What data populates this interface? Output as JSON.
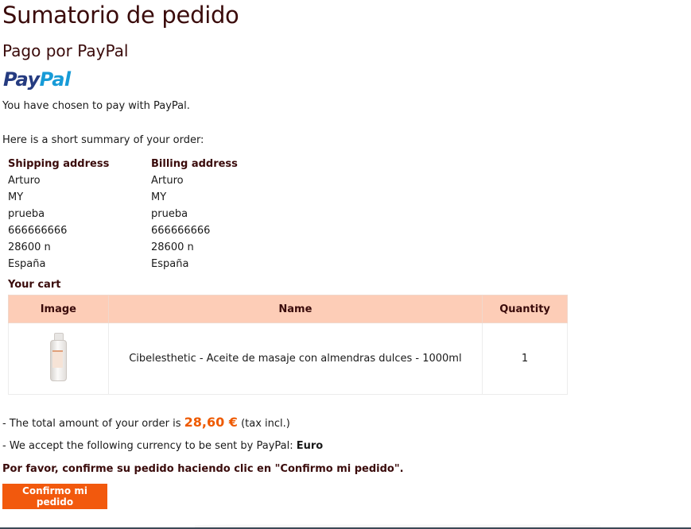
{
  "page": {
    "title": "Sumatorio de pedido",
    "subtitle": "Pago por PayPal"
  },
  "logo": {
    "pay": "Pay",
    "pal": "Pal"
  },
  "intro": {
    "chosen_text": "You have chosen to pay with PayPal.",
    "summary_text": "Here is a short summary of your order:"
  },
  "shipping_address": {
    "heading": "Shipping address",
    "lines": [
      "Arturo",
      "MY",
      "prueba",
      "666666666",
      "28600 n",
      "España"
    ]
  },
  "billing_address": {
    "heading": "Billing address",
    "lines": [
      "Arturo",
      "MY",
      "prueba",
      "666666666",
      "28600 n",
      "España"
    ]
  },
  "cart": {
    "heading": "Your cart",
    "columns": [
      "Image",
      "Name",
      "Quantity"
    ],
    "rows": [
      {
        "image_icon": "product-bottle-icon",
        "name": "Cibelesthetic - Aceite de masaje con almendras dulces - 1000ml",
        "quantity": "1"
      }
    ]
  },
  "total": {
    "prefix": "- The total amount of your order is ",
    "amount": "28,60 €",
    "suffix": " (tax incl.)"
  },
  "currency": {
    "prefix": "- We accept the following currency to be sent by PayPal: ",
    "value": "Euro"
  },
  "confirm": {
    "text": "Por favor, confirme su pedido haciendo clic en \"Confirmo mi pedido\".",
    "button_label": "Confirmo mi pedido"
  },
  "colors": {
    "accent": "#f2590d",
    "total_amount": "#ee5a00",
    "table_header_bg": "#fdcdb7",
    "heading_text": "#3a0b0b",
    "paypal_dark": "#253b80",
    "paypal_light": "#179bd7"
  }
}
